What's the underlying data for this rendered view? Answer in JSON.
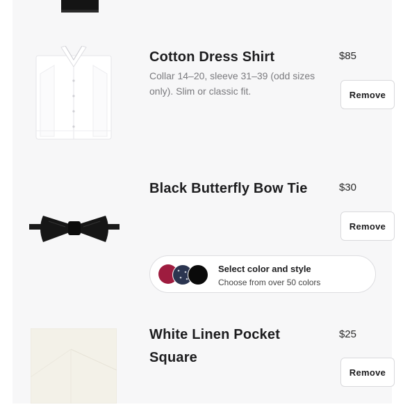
{
  "products": [
    {
      "title": "Cotton Dress Shirt",
      "price": "$85",
      "description": "Collar 14–20, sleeve 31–39 (odd sizes only). Slim or classic fit.",
      "remove_label": "Remove",
      "image_icon": "dress-shirt-image"
    },
    {
      "title": "Black Butterfly Bow Tie",
      "price": "$30",
      "remove_label": "Remove",
      "image_icon": "bow-tie-image",
      "color_selector": {
        "title": "Select color and style",
        "subtitle": "Choose from over 50 colors",
        "swatch_colors": [
          "#9e1c3f",
          "#2b3550",
          "#0a0a0a"
        ]
      }
    },
    {
      "title_line1": "White Linen Pocket",
      "title_line2": "Square",
      "price": "$25",
      "remove_label": "Remove",
      "image_icon": "pocket-square-image"
    }
  ]
}
